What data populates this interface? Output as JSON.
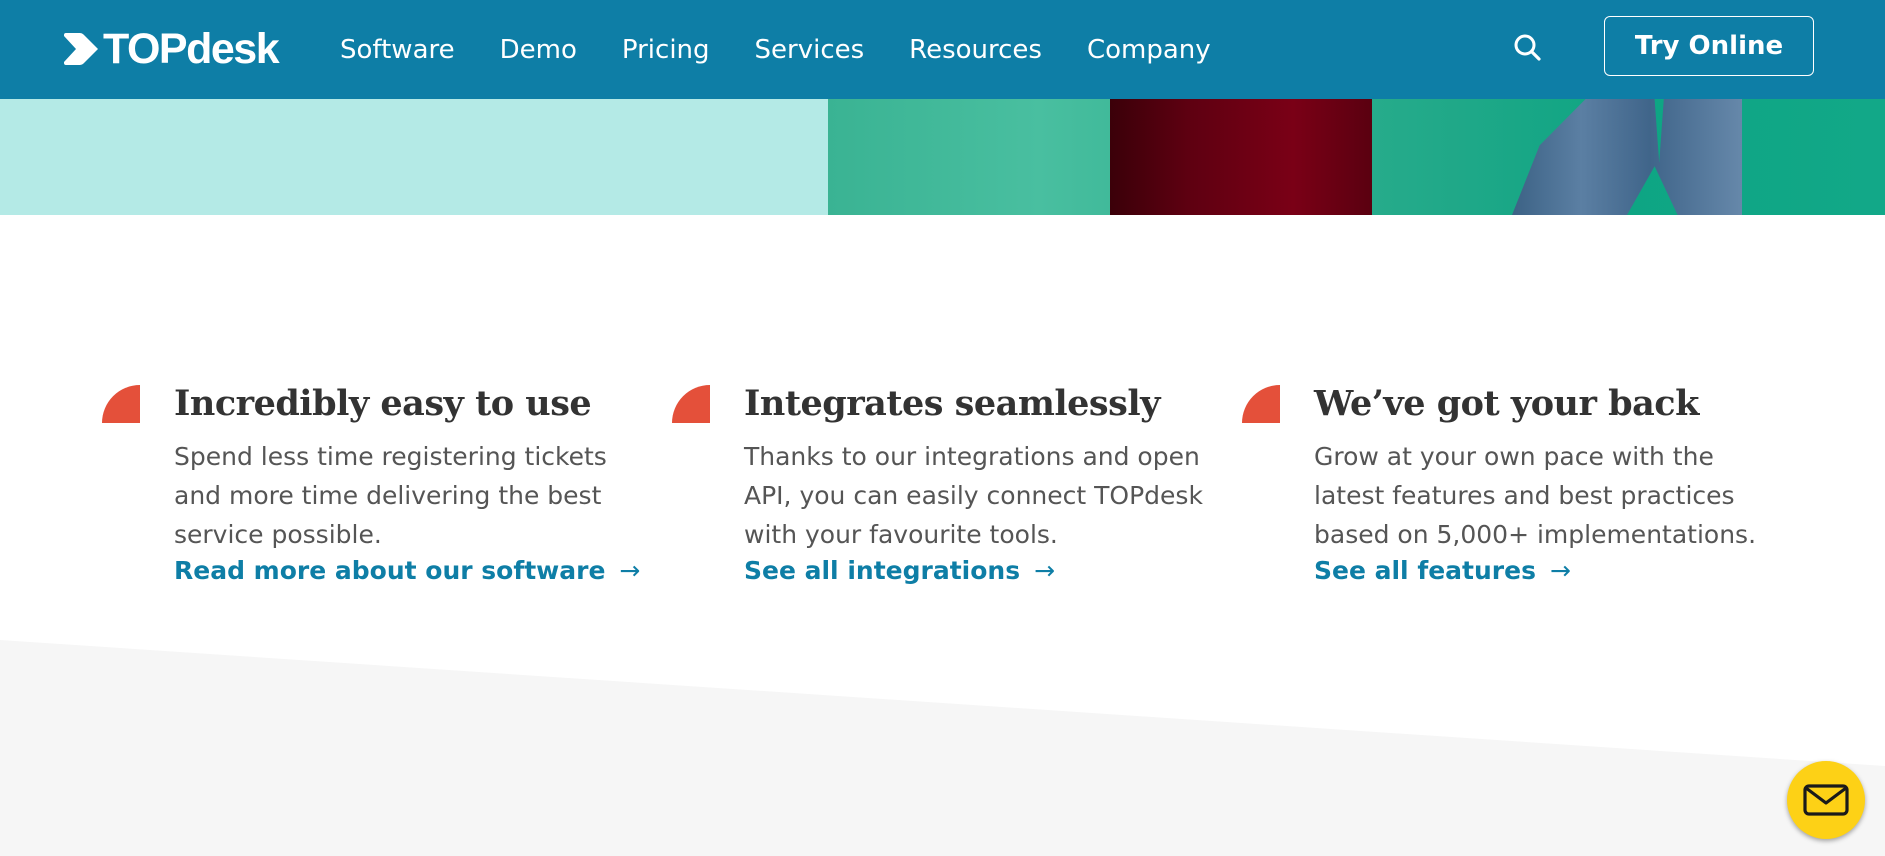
{
  "header": {
    "logo_text": "TOPdesk",
    "nav": [
      {
        "label": "Software"
      },
      {
        "label": "Demo"
      },
      {
        "label": "Pricing"
      },
      {
        "label": "Services"
      },
      {
        "label": "Resources"
      },
      {
        "label": "Company"
      }
    ],
    "search_icon": "search-icon",
    "cta_label": "Try Online"
  },
  "features": [
    {
      "icon": "quarter-circle-icon",
      "title": "Incredibly easy to use",
      "description": "Spend less time registering tickets and more time delivering the best service possible.",
      "link_label": "Read more about our software",
      "link_arrow": "→"
    },
    {
      "icon": "quarter-circle-icon",
      "title": "Integrates seamlessly",
      "description": "Thanks to our integrations and open API, you can easily connect TOPdesk with your favourite tools.",
      "link_label": "See all integrations",
      "link_arrow": "→"
    },
    {
      "icon": "quarter-circle-icon",
      "title": "We’ve got your back",
      "description": "Grow at your own pace with the latest features and best practices based on 5,000+ implementations.",
      "link_label": "See all features",
      "link_arrow": "→"
    }
  ],
  "chat": {
    "icon": "mail-icon"
  },
  "colors": {
    "header_bg": "#0e7ea6",
    "accent_link": "#0e7ea6",
    "feature_icon": "#e4503a",
    "hero_bg": "#b4eae6",
    "chat_button": "#fdd116"
  }
}
